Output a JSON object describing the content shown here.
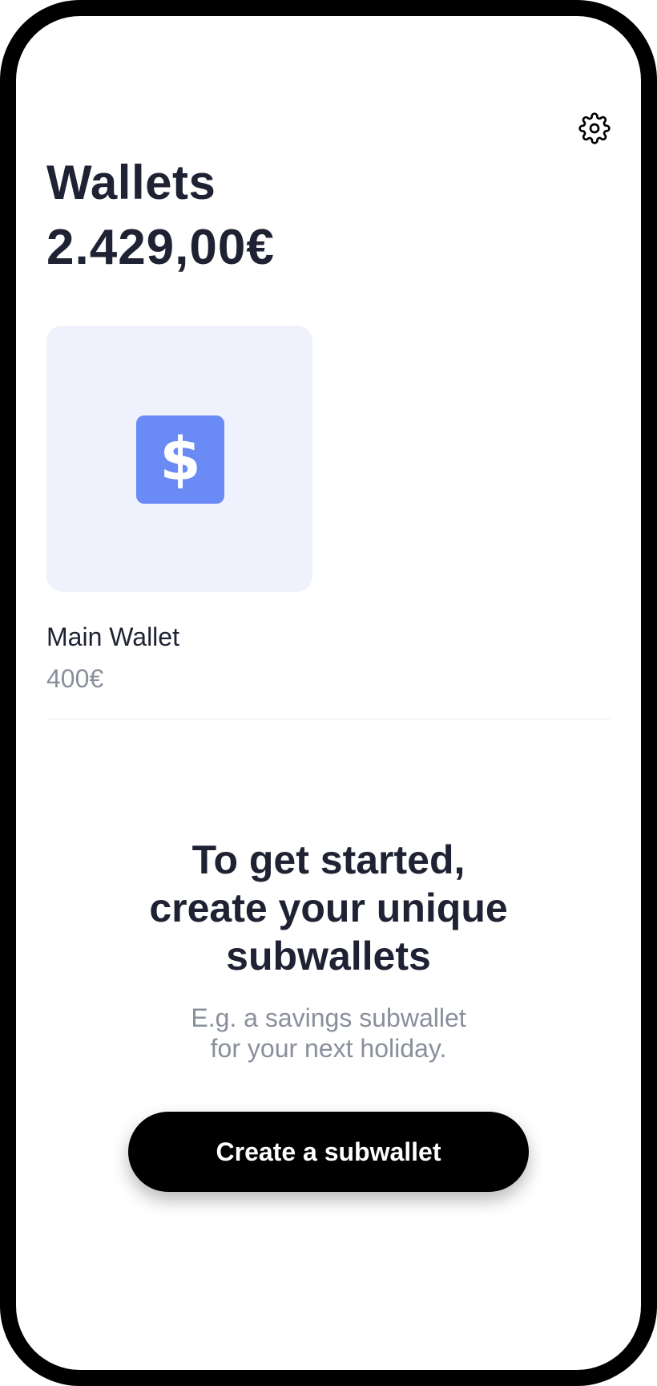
{
  "header": {
    "title": "Wallets",
    "total_balance": "2.429,00€",
    "settings_icon": "gear-icon"
  },
  "wallets": [
    {
      "name": "Main Wallet",
      "amount": "400€",
      "icon": "dollar-icon",
      "icon_glyph": "$",
      "icon_color": "#6a8af6",
      "card_color": "#eff1fc"
    }
  ],
  "empty_state": {
    "heading": "To get started,\ncreate your unique\nsubwallets",
    "subtext": "E.g. a savings subwallet\nfor your next holiday.",
    "button_label": "Create a subwallet"
  },
  "colors": {
    "text_primary": "#1f2233",
    "text_secondary": "#8a8f9c",
    "button_bg": "#000000",
    "frame": "#000000"
  }
}
